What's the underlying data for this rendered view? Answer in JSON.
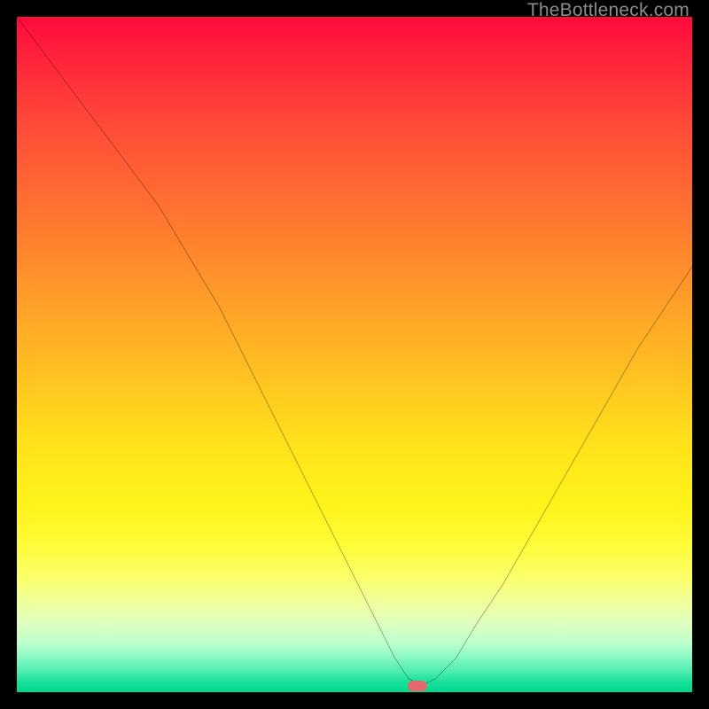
{
  "watermark": "TheBottleneck.com",
  "marker": {
    "x_pct": 59.3,
    "y_pct": 99.1,
    "color": "#e26a6d"
  },
  "chart_data": {
    "type": "line",
    "title": "",
    "xlabel": "",
    "ylabel": "",
    "xlim": [
      0,
      100
    ],
    "ylim": [
      0,
      100
    ],
    "grid": false,
    "legend": false,
    "series": [
      {
        "name": "bottleneck-curve",
        "x": [
          0,
          3,
          6,
          9,
          12,
          15,
          18,
          21,
          24,
          27,
          30,
          33,
          36,
          39,
          42,
          45,
          48,
          51,
          54,
          56,
          58,
          60,
          62,
          65,
          68,
          72,
          76,
          80,
          84,
          88,
          92,
          96,
          100
        ],
        "values": [
          100,
          96,
          92,
          88,
          84,
          80,
          76,
          72,
          67,
          62,
          57,
          51,
          45,
          39,
          33,
          27,
          21,
          15,
          9,
          5,
          2,
          1,
          2,
          5,
          10,
          16,
          23,
          30,
          37,
          44,
          51,
          57,
          63
        ]
      }
    ],
    "background_gradient_stops": [
      {
        "pos": 0.0,
        "color": "#ff0a3c"
      },
      {
        "pos": 0.26,
        "color": "#ff6a32"
      },
      {
        "pos": 0.56,
        "color": "#ffcb1f"
      },
      {
        "pos": 0.78,
        "color": "#fffb36"
      },
      {
        "pos": 0.93,
        "color": "#b8ffce"
      },
      {
        "pos": 1.0,
        "color": "#00d88e"
      }
    ],
    "annotations": [
      {
        "type": "marker",
        "shape": "rounded-rect",
        "x": 59.3,
        "y": 0.9,
        "color": "#e26a6d"
      }
    ]
  }
}
